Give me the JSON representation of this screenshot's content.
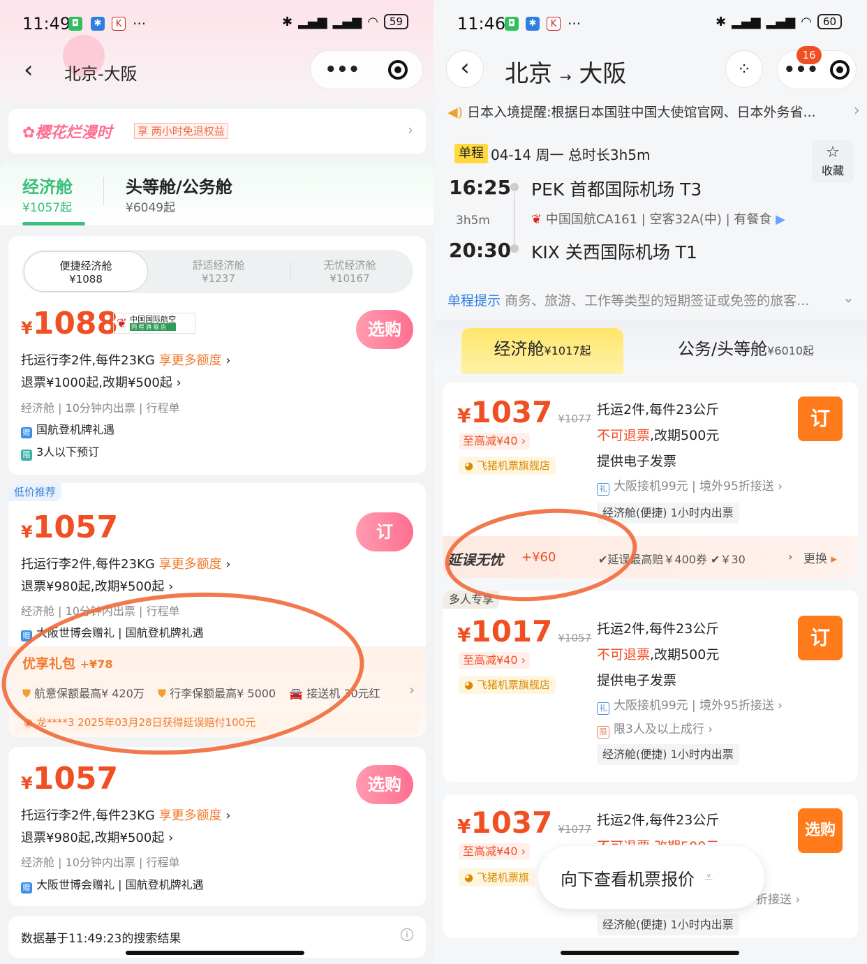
{
  "left": {
    "status_time": "11:49",
    "status_more": "···",
    "battery": "59",
    "nav_title": "北京-大阪",
    "banner": {
      "title": "樱花烂漫时",
      "tag": "享",
      "text": "两小时免退权益"
    },
    "tabs": [
      {
        "label": "经济舱",
        "price": "¥1057起"
      },
      {
        "label": "头等舱/公务舱",
        "price": "¥6049起"
      }
    ],
    "subtabs": [
      {
        "label": "便捷经济舱",
        "price": "¥1088"
      },
      {
        "label": "舒适经济舱",
        "price": "¥1237"
      },
      {
        "label": "无忧经济舱",
        "price": "¥10167"
      }
    ],
    "airline_logo": {
      "cn": "中国国际航空",
      "sub": "同 程 旗 舰 店"
    },
    "offers": [
      {
        "price": "1088",
        "currency": "¥",
        "baggage": "托运行李2件,每件23KG",
        "more": "享更多额度",
        "refund": "退票¥1000起,改期¥500起",
        "meta": "经济舱 | 10分钟内出票 | 行程单",
        "extra1_tag": "赠",
        "extra1": "国航登机牌礼遇",
        "extra2_tag": "限",
        "extra2": "3人以下预订",
        "button": "选购"
      },
      {
        "badge": "低价推荐",
        "price": "1057",
        "currency": "¥",
        "baggage": "托运行李2件,每件23KG",
        "more": "享更多额度",
        "refund": "退票¥980起,改期¥500起",
        "meta": "经济舱 | 10分钟内出票 | 行程单",
        "extra1_tag": "赠",
        "extra1": "大阪世博会赠礼 | 国航登机牌礼遇",
        "gift_title": "优享礼包",
        "gift_price": "+¥78",
        "gift_items": [
          "航意保额最高¥ 420万",
          "行李保额最高¥ 5000",
          "接送机 30元红"
        ],
        "claim": "龙****3 2025年03月28日获得延误赔付100元",
        "button": "订"
      },
      {
        "price": "1057",
        "currency": "¥",
        "baggage": "托运行李2件,每件23KG",
        "more": "享更多额度",
        "refund": "退票¥980起,改期¥500起",
        "meta": "经济舱 | 10分钟内出票 | 行程单",
        "extra1_tag": "赠",
        "extra1": "大阪世博会赠礼 | 国航登机牌礼遇",
        "button": "选购"
      }
    ],
    "footer": "数据基于11:49:23的搜索结果",
    "info_icon": "i"
  },
  "right": {
    "status_time": "11:46",
    "status_more": "···",
    "battery": "60",
    "nav_from": "北京",
    "nav_arrow": "→",
    "nav_to": "大阪",
    "badge_count": "16",
    "notice": "日本入境提醒:根据日本国驻中国大使馆官网、日本外务省...",
    "trip": {
      "type": "单程",
      "date": "04-14 周一",
      "duration_label": "总时长3h5m",
      "fav": "收藏"
    },
    "dep": {
      "time": "16:25",
      "airport": "PEK 首都国际机场 T3"
    },
    "mid": {
      "duration": "3h5m",
      "airline": "中国国航CA161",
      "plane": "空客32A(中)",
      "meal": "有餐食"
    },
    "arr": {
      "time": "20:30",
      "airport": "KIX 关西国际机场 T1"
    },
    "tip": {
      "title": "单程提示",
      "text": "商务、旅游、工作等类型的短期签证或免签的旅客..."
    },
    "tabs": [
      {
        "label": "经济舱",
        "price": "¥1017起"
      },
      {
        "label": "公务/头等舱",
        "price": "¥6010起"
      }
    ],
    "offers": [
      {
        "price": "1037",
        "orig": "¥1077",
        "currency": "¥",
        "discount": "至高减¥40 ›",
        "shop": "飞猪机票旗舰店",
        "l1": "托运2件,每件23公斤",
        "l2_red": "不可退票",
        "l2": ",改期500元",
        "l3": "提供电子发票",
        "gift_tag": "礼",
        "gift": "大阪接机99元 | 境外95折接送 ›",
        "chip": "经济舱(便捷)  1小时内出票",
        "button": "订",
        "delay_title": "延误无忧",
        "delay_price": "+¥60",
        "delay_items": "✔延误最高赔￥400券  ✔￥30",
        "delay_change": "更换"
      },
      {
        "badge": "多人专享",
        "price": "1017",
        "orig": "¥1057",
        "currency": "¥",
        "discount": "至高减¥40 ›",
        "shop": "飞猪机票旗舰店",
        "l1": "托运2件,每件23公斤",
        "l2_red": "不可退票",
        "l2": ",改期500元",
        "l3": "提供电子发票",
        "gift_tag": "礼",
        "gift": "大阪接机99元 | 境外95折接送 ›",
        "limit_tag": "限",
        "limit": "限3人及以上成行 ›",
        "chip": "经济舱(便捷)  1小时内出票",
        "button": "订"
      },
      {
        "price": "1037",
        "orig": "¥1077",
        "currency": "¥",
        "discount": "至高减¥40 ›",
        "shop": "飞猪机票旗",
        "l1": "托运2件,每件23公斤",
        "l2_cut": "不可退票,改期500元",
        "gift_tail": "折接送 ›",
        "chip": "经济舱(便捷)  1小时内出票",
        "button": "选购"
      }
    ],
    "float": "向下查看机票报价"
  },
  "colors": {
    "accent_red": "#f04f23",
    "accent_orange": "#ff7a1a",
    "green": "#3bbf7a",
    "annotation": "#ef6a3a"
  }
}
